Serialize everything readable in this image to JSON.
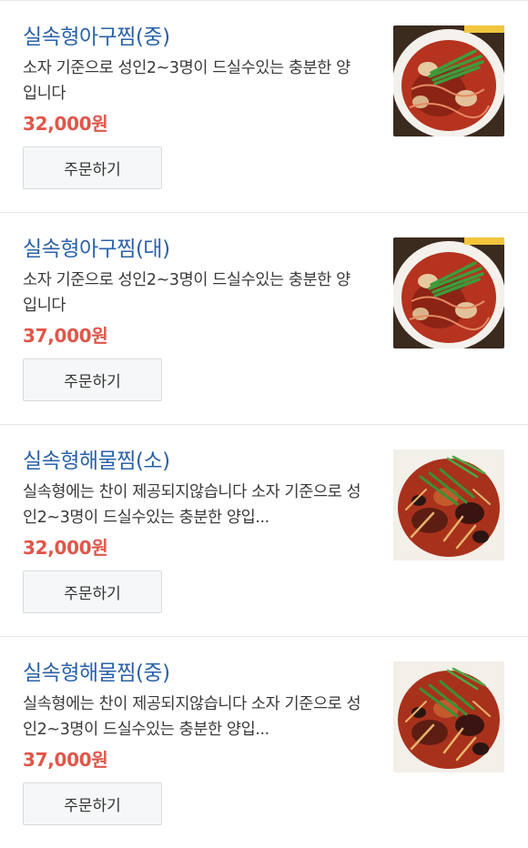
{
  "menu_items": [
    {
      "title": "실속형아구찜(중)",
      "description": "소자 기준으로 성인2~3명이 드실수있는 충분한 양입니다",
      "price": "32,000원",
      "order_label": "주문하기",
      "image": "braised-monkfish-photo"
    },
    {
      "title": "실속형아구찜(대)",
      "description": "소자 기준으로 성인2~3명이 드실수있는 충분한 양입니다",
      "price": "37,000원",
      "order_label": "주문하기",
      "image": "braised-monkfish-photo"
    },
    {
      "title": "실속형해물찜(소)",
      "description": "실속형에는 찬이 제공되지않습니다 소자 기준으로 성인2~3명이 드실수있는 충분한 양입...",
      "price": "32,000원",
      "order_label": "주문하기",
      "image": "braised-seafood-photo"
    },
    {
      "title": "실속형해물찜(중)",
      "description": "실속형에는 찬이 제공되지않습니다 소자 기준으로 성인2~3명이 드실수있는 충분한 양입...",
      "price": "37,000원",
      "order_label": "주문하기",
      "image": "braised-seafood-photo"
    }
  ],
  "colors": {
    "title": "#2a62a8",
    "price": "#e0564a",
    "button_bg": "#f6f7f9"
  }
}
